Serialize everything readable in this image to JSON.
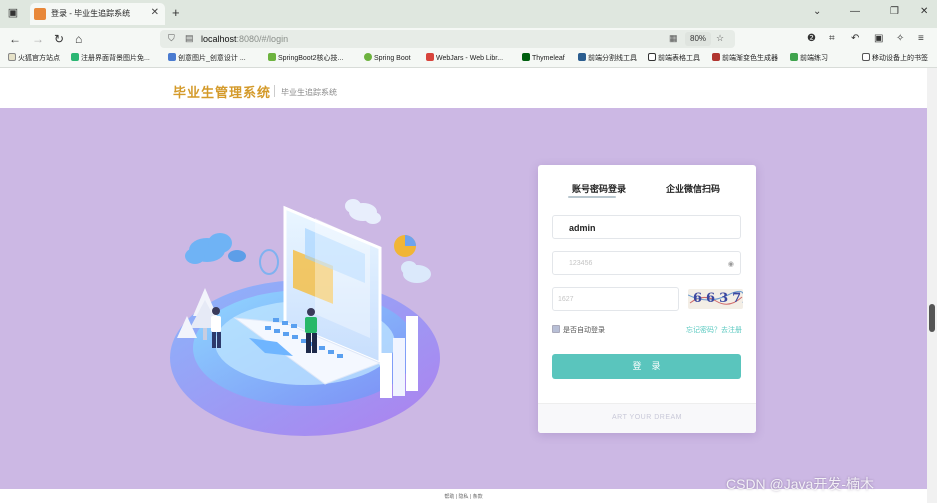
{
  "browser": {
    "tab_title": "登录 - 毕业生追踪系统",
    "url_host": "localhost",
    "url_path": ":8080/#/login",
    "zoom": "80%",
    "bookmarks": [
      {
        "label": "火狐官方站点",
        "color": "#e66000"
      },
      {
        "label": "注册界面背景图片免...",
        "color": "#2bb673"
      },
      {
        "label": "创意图片_创意设计 ...",
        "color": "#4a7bd0"
      },
      {
        "label": "SpringBoot2核心技...",
        "color": "#6db33f"
      },
      {
        "label": "Spring Boot",
        "color": "#6db33f"
      },
      {
        "label": "WebJars - Web Libr...",
        "color": "#d8443c"
      },
      {
        "label": "Thymeleaf",
        "color": "#005f0f"
      },
      {
        "label": "前端分割线工具",
        "color": "#2a5d8f"
      },
      {
        "label": "前端表格工具",
        "color": "#333333"
      },
      {
        "label": "前端渐变色生成器",
        "color": "#b0352f"
      },
      {
        "label": "前端练习",
        "color": "#3fa34d"
      },
      {
        "label": "移动设备上的书签",
        "color": "#555555"
      }
    ]
  },
  "header": {
    "title": "毕业生管理系统",
    "subtitle": "毕业生追踪系统"
  },
  "login": {
    "tab_password": "账号密码登录",
    "tab_wechat": "企业微信扫码",
    "username_value": "admin",
    "password_placeholder": "123456",
    "captcha_placeholder": "1627",
    "captcha_text": "6637",
    "remember_label": "是否自动登录",
    "forgot_label": "忘记密码？去注册",
    "submit_label": "登录",
    "slogan": "ART YOUR DREAM"
  },
  "footer": {
    "links": "帮助 | 隐私 | 条款"
  },
  "watermark": "CSDN @Java开发-楠木",
  "colors": {
    "hero_bg": "#ccb8e4",
    "accent": "#5ac5bd",
    "brand_title": "#d49a2a"
  }
}
